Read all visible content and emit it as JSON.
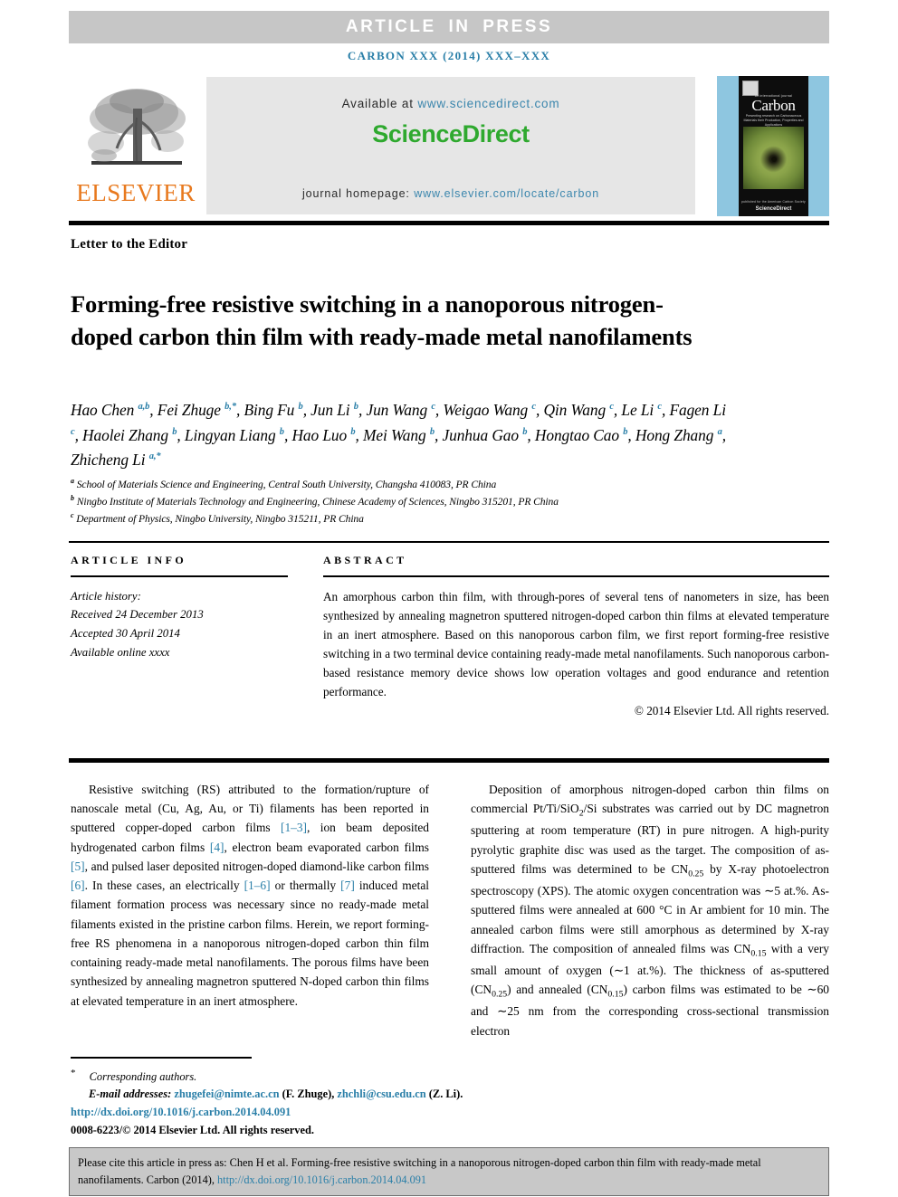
{
  "banner": {
    "text": "ARTICLE IN PRESS"
  },
  "journal_line": {
    "text": "CARBON XXX (2014) XXX–XXX"
  },
  "masthead": {
    "publisher": "ELSEVIER",
    "available_prefix": "Available at",
    "available_url": "www.sciencedirect.com",
    "sciencedirect_logo": "ScienceDirect",
    "homepage_prefix": "journal homepage:",
    "homepage_url": "www.elsevier.com/locate/carbon",
    "cover": {
      "title": "Carbon",
      "kicker": "an international journal",
      "subtitle": "Presenting research on Carbonaceous Materials their Production, Properties and Applications",
      "bottom_note": "published for the American Carbon Society",
      "brand": "ScienceDirect"
    }
  },
  "article": {
    "kind": "Letter to the Editor",
    "title": "Forming-free resistive switching in a nanoporous nitrogen-doped carbon thin film with ready-made metal nanofilaments",
    "authors_html": "Hao Chen <sup>a,b</sup>, Fei Zhuge <sup>b,*</sup>, Bing Fu <sup>b</sup>, Jun Li <sup>b</sup>, Jun Wang <sup>c</sup>, Weigao Wang <sup>c</sup>, Qin Wang <sup>c</sup>, Le Li <sup>c</sup>, Fagen Li <sup>c</sup>, Haolei Zhang <sup>b</sup>, Lingyan Liang <sup>b</sup>, Hao Luo <sup>b</sup>, Mei Wang <sup>b</sup>, Junhua Gao <sup>b</sup>, Hongtao Cao <sup>b</sup>, Hong Zhang <sup>a</sup>, Zhicheng Li <sup>a,*</sup>",
    "affiliations": [
      {
        "mark": "a",
        "text": "School of Materials Science and Engineering, Central South University, Changsha 410083, PR China"
      },
      {
        "mark": "b",
        "text": "Ningbo Institute of Materials Technology and Engineering, Chinese Academy of Sciences, Ningbo 315201, PR China"
      },
      {
        "mark": "c",
        "text": "Department of Physics, Ningbo University, Ningbo 315211, PR China"
      }
    ]
  },
  "article_info": {
    "heading": "ARTICLE INFO",
    "history_label": "Article history:",
    "received": "Received 24 December 2013",
    "accepted": "Accepted 30 April 2014",
    "available_online": "Available online xxxx"
  },
  "abstract": {
    "heading": "ABSTRACT",
    "text": "An amorphous carbon thin film, with through-pores of several tens of nanometers in size, has been synthesized by annealing magnetron sputtered nitrogen-doped carbon thin films at elevated temperature in an inert atmosphere. Based on this nanoporous carbon film, we first report forming-free resistive switching in a two terminal device containing ready-made metal nanofilaments. Such nanoporous carbon-based resistance memory device shows low operation voltages and good endurance and retention performance.",
    "copyright": "© 2014 Elsevier Ltd. All rights reserved."
  },
  "body": {
    "left_paragraph_html": "Resistive switching (RS) attributed to the formation/rupture of nanoscale metal (Cu, Ag, Au, or Ti) filaments has been reported in sputtered copper-doped carbon films <span class=\"ref\">[1–3]</span>, ion beam deposited hydrogenated carbon films <span class=\"ref\">[4]</span>, electron beam evaporated carbon films <span class=\"ref\">[5]</span>, and pulsed laser deposited nitrogen-doped diamond-like carbon films <span class=\"ref\">[6]</span>. In these cases, an electrically <span class=\"ref\">[1–6]</span> or thermally <span class=\"ref\">[7]</span> induced metal filament formation process was necessary since no ready-made metal filaments existed in the pristine carbon films. Herein, we report forming-free RS phenomena in a nanoporous nitrogen-doped carbon thin film containing ready-made metal nanofilaments. The porous films have been synthesized by annealing magnetron sputtered N-doped carbon thin films at elevated temperature in an inert atmosphere.",
    "right_paragraph_html": "Deposition of amorphous nitrogen-doped carbon thin films on commercial Pt/Ti/SiO<sub>2</sub>/Si substrates was carried out by DC magnetron sputtering at room temperature (RT) in pure nitrogen. A high-purity pyrolytic graphite disc was used as the target. The composition of as-sputtered films was determined to be CN<sub>0.25</sub> by X-ray photoelectron spectroscopy (XPS). The atomic oxygen concentration was ∼5 at.%. As-sputtered films were annealed at 600 °C in Ar ambient for 10 min. The annealed carbon films were still amorphous as determined by X-ray diffraction. The composition of annealed films was CN<sub>0.15</sub> with a very small amount of oxygen (∼1 at.%). The thickness of as-sputtered (CN<sub>0.25</sub>) and annealed (CN<sub>0.15</sub>) carbon films was estimated to be ∼60 and ∼25 nm from the corresponding cross-sectional transmission electron"
  },
  "footnotes": {
    "corresponding": "Corresponding authors.",
    "email_label": "E-mail addresses:",
    "email1": "zhugefei@nimte.ac.cn",
    "email1_who": "(F. Zhuge),",
    "email2": "zhchli@csu.edu.cn",
    "email2_who": "(Z. Li).",
    "doi": "http://dx.doi.org/10.1016/j.carbon.2014.04.091",
    "issn": "0008-6223/© 2014 Elsevier Ltd. All rights reserved."
  },
  "cite_box": {
    "text_before": "Please cite this article in press as: Chen H et al. Forming-free resistive switching in a nanoporous nitrogen-doped carbon thin film with ready-made metal nanofilaments. Carbon (2014),",
    "link": "http://dx.doi.org/10.1016/j.carbon.2014.04.091"
  }
}
